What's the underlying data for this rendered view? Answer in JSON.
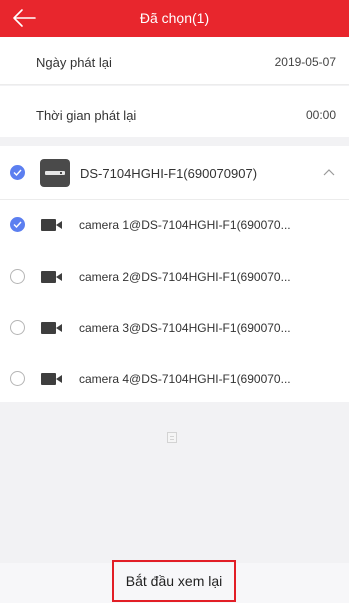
{
  "header": {
    "title": "Đã chọn(1)",
    "back_icon": "arrow-left-icon",
    "background": "#e8262d"
  },
  "playback": {
    "date_label": "Ngày phát lại",
    "date_value": "2019-05-07",
    "time_label": "Thời gian phát lại",
    "time_value": "00:00"
  },
  "device": {
    "name": "DS-7104HGHI-F1(690070907)",
    "checked": true,
    "expand_icon": "chevron-up-icon",
    "cameras": [
      {
        "name": "camera 1@DS-7104HGHI-F1(690070...",
        "checked": true
      },
      {
        "name": "camera 2@DS-7104HGHI-F1(690070...",
        "checked": false
      },
      {
        "name": "camera 3@DS-7104HGHI-F1(690070...",
        "checked": false
      },
      {
        "name": "camera 4@DS-7104HGHI-F1(690070...",
        "checked": false
      }
    ]
  },
  "footer": {
    "start_label": "Bắt đầu xem lại"
  },
  "colors": {
    "accent": "#e8262d",
    "check": "#5c7ff0"
  }
}
